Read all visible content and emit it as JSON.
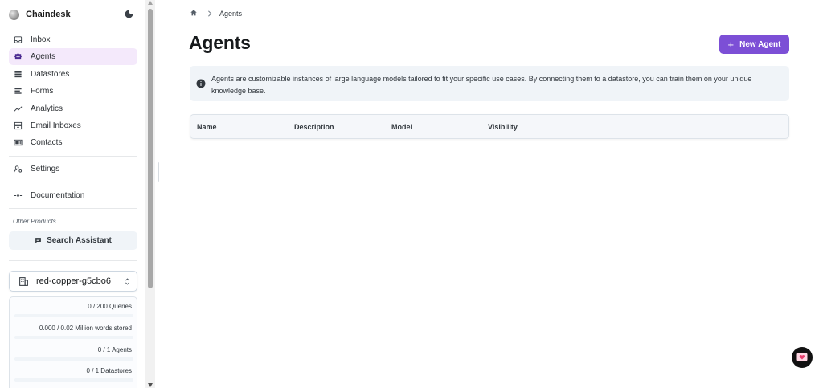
{
  "app": {
    "name": "Chaindesk"
  },
  "sidebar": {
    "items": [
      {
        "label": "Inbox",
        "icon": "inbox-icon",
        "active": false
      },
      {
        "label": "Agents",
        "icon": "agents-icon",
        "active": true
      },
      {
        "label": "Datastores",
        "icon": "datastores-icon",
        "active": false
      },
      {
        "label": "Forms",
        "icon": "forms-icon",
        "active": false
      },
      {
        "label": "Analytics",
        "icon": "analytics-icon",
        "active": false
      },
      {
        "label": "Email Inboxes",
        "icon": "email-inbox-icon",
        "active": false
      },
      {
        "label": "Contacts",
        "icon": "contacts-icon",
        "active": false
      }
    ],
    "settings_label": "Settings",
    "documentation_label": "Documentation",
    "other_products_label": "Other Products",
    "search_assistant_label": "Search Assistant",
    "organization": "red-copper-g5cbo6",
    "usage": [
      {
        "label": "0 / 200 Queries",
        "progress": 0
      },
      {
        "label": "0.000 / 0.02 Million words stored",
        "progress": 0
      },
      {
        "label": "0 / 1 Agents",
        "progress": 0
      },
      {
        "label": "0 / 1 Datastores",
        "progress": 0
      }
    ]
  },
  "breadcrumb": {
    "current": "Agents"
  },
  "main": {
    "title": "Agents",
    "new_agent_label": "New Agent",
    "info_text": "Agents are customizable instances of large language models tailored to fit your specific use cases. By connecting them to a datastore, you can train them on your unique knowledge base.",
    "table": {
      "columns": [
        "Name",
        "Description",
        "Model",
        "Visibility"
      ]
    }
  },
  "colors": {
    "accent": "#7c4fd6",
    "active_nav_bg": "#f4e9fb",
    "alert_bg": "#f0f4f8"
  }
}
